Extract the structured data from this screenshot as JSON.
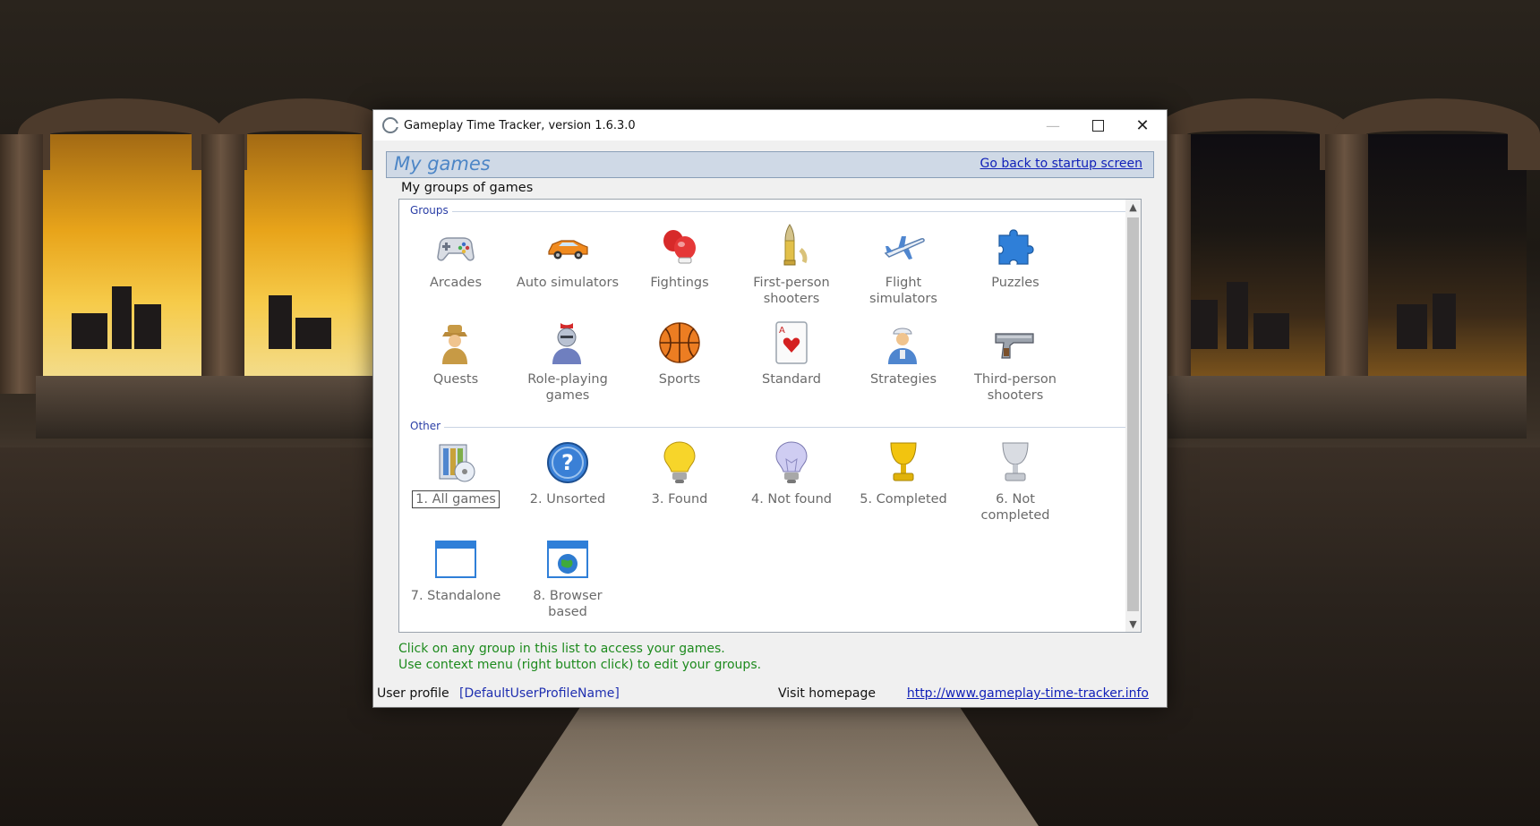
{
  "window": {
    "title": "Gameplay Time Tracker, version 1.6.3.0",
    "controls": {
      "minimize": "—",
      "close": "✕"
    }
  },
  "header": {
    "title": "My games",
    "back_link": "Go back to startup screen"
  },
  "subtitle": "My groups of games",
  "sections": {
    "groups": {
      "label": "Groups",
      "items": [
        {
          "label": "Arcades",
          "icon": "gamepad-icon"
        },
        {
          "label": "Auto simulators",
          "icon": "car-icon"
        },
        {
          "label": "Fightings",
          "icon": "boxing-gloves-icon"
        },
        {
          "label": "First-person shooters",
          "icon": "bullet-icon"
        },
        {
          "label": "Flight simulators",
          "icon": "airplane-icon"
        },
        {
          "label": "Puzzles",
          "icon": "puzzle-piece-icon"
        },
        {
          "label": "Quests",
          "icon": "detective-icon"
        },
        {
          "label": "Role-playing games",
          "icon": "knight-icon"
        },
        {
          "label": "Sports",
          "icon": "basketball-icon"
        },
        {
          "label": "Standard",
          "icon": "playing-card-icon"
        },
        {
          "label": "Strategies",
          "icon": "general-icon"
        },
        {
          "label": "Third-person shooters",
          "icon": "pistol-icon"
        }
      ]
    },
    "other": {
      "label": "Other",
      "items": [
        {
          "label": "1. All games",
          "icon": "all-games-icon",
          "selected": true
        },
        {
          "label": "2. Unsorted",
          "icon": "question-icon"
        },
        {
          "label": "3. Found",
          "icon": "lightbulb-on-icon"
        },
        {
          "label": "4. Not found",
          "icon": "lightbulb-off-icon"
        },
        {
          "label": "5. Completed",
          "icon": "gold-cup-icon"
        },
        {
          "label": "6. Not completed",
          "icon": "silver-cup-icon"
        },
        {
          "label": "7. Standalone",
          "icon": "window-icon"
        },
        {
          "label": "8. Browser based",
          "icon": "browser-globe-icon"
        }
      ]
    }
  },
  "hints": [
    "Click on any group in this list to access your games.",
    "Use context menu (right button click) to edit your groups."
  ],
  "status": {
    "profile_label": "User profile",
    "profile_value": "[DefaultUserProfileName]",
    "visit_label": "Visit homepage",
    "homepage": "http://www.gameplay-time-tracker.info"
  },
  "colors": {
    "header_title": "#4d86c6",
    "link": "#0f1fb8",
    "hint": "#1d8a1d",
    "section_label": "#2a3ea6",
    "item_label": "#6a6a6a"
  }
}
